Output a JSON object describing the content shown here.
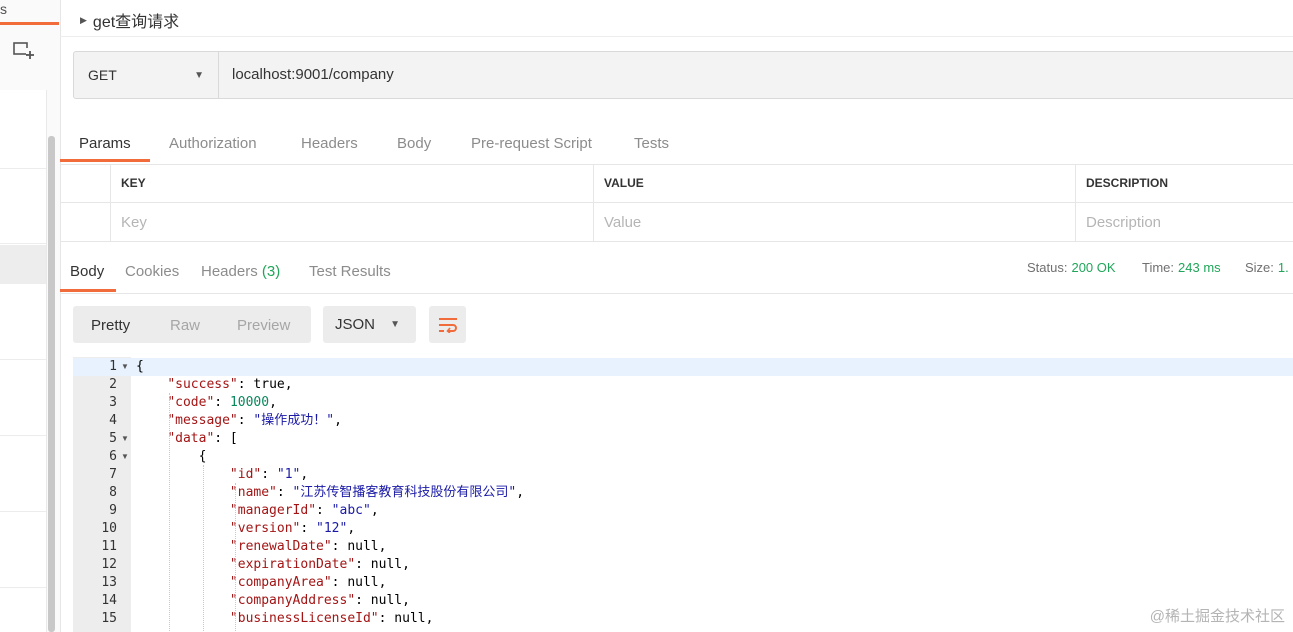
{
  "sidebar": {
    "tab_label": "s",
    "new_collection_icon": "new-collection-icon"
  },
  "request": {
    "title": "get查询请求",
    "method": "GET",
    "url": "localhost:9001/company"
  },
  "request_tabs": [
    "Params",
    "Authorization",
    "Headers",
    "Body",
    "Pre-request Script",
    "Tests"
  ],
  "params": {
    "headers": [
      "KEY",
      "VALUE",
      "DESCRIPTION"
    ],
    "placeholders": [
      "Key",
      "Value",
      "Description"
    ]
  },
  "response": {
    "tabs": [
      "Body",
      "Cookies",
      "Headers",
      "Test Results"
    ],
    "headers_count": "(3)",
    "status_label": "Status:",
    "status_value": "200 OK",
    "time_label": "Time:",
    "time_value": "243 ms",
    "size_label": "Size:",
    "size_value": "1."
  },
  "view": {
    "modes": [
      "Pretty",
      "Raw",
      "Preview"
    ],
    "format": "JSON",
    "wrap_icon": "wrap-lines-icon"
  },
  "code_lines": [
    {
      "n": "1",
      "fold": true,
      "html": "{"
    },
    {
      "n": "2",
      "fold": false,
      "html": "    <span class=\"k\">\"success\"</span>: true,"
    },
    {
      "n": "3",
      "fold": false,
      "html": "    <span class=\"k\">\"code\"</span>: <span class=\"n\">10000</span>,"
    },
    {
      "n": "4",
      "fold": false,
      "html": "    <span class=\"k\">\"message\"</span>: <span class=\"s\">\"操作成功！\"</span>,"
    },
    {
      "n": "5",
      "fold": true,
      "html": "    <span class=\"k\">\"data\"</span>: ["
    },
    {
      "n": "6",
      "fold": true,
      "html": "        {"
    },
    {
      "n": "7",
      "fold": false,
      "html": "            <span class=\"k\">\"id\"</span>: <span class=\"s\">\"1\"</span>,"
    },
    {
      "n": "8",
      "fold": false,
      "html": "            <span class=\"k\">\"name\"</span>: <span class=\"s\">\"江苏传智播客教育科技股份有限公司\"</span>,"
    },
    {
      "n": "9",
      "fold": false,
      "html": "            <span class=\"k\">\"managerId\"</span>: <span class=\"s\">\"abc\"</span>,"
    },
    {
      "n": "10",
      "fold": false,
      "html": "            <span class=\"k\">\"version\"</span>: <span class=\"s\">\"12\"</span>,"
    },
    {
      "n": "11",
      "fold": false,
      "html": "            <span class=\"k\">\"renewalDate\"</span>: null,"
    },
    {
      "n": "12",
      "fold": false,
      "html": "            <span class=\"k\">\"expirationDate\"</span>: null,"
    },
    {
      "n": "13",
      "fold": false,
      "html": "            <span class=\"k\">\"companyArea\"</span>: null,"
    },
    {
      "n": "14",
      "fold": false,
      "html": "            <span class=\"k\">\"companyAddress\"</span>: null,"
    },
    {
      "n": "15",
      "fold": false,
      "html": "            <span class=\"k\">\"businessLicenseId\"</span>: null,"
    }
  ],
  "watermark": "@稀土掘金技术社区",
  "colors": {
    "accent": "#f26b3a",
    "status_green": "#21a55a",
    "json_key": "#a31515",
    "json_string": "#1a1aa6",
    "json_number": "#09885a"
  }
}
